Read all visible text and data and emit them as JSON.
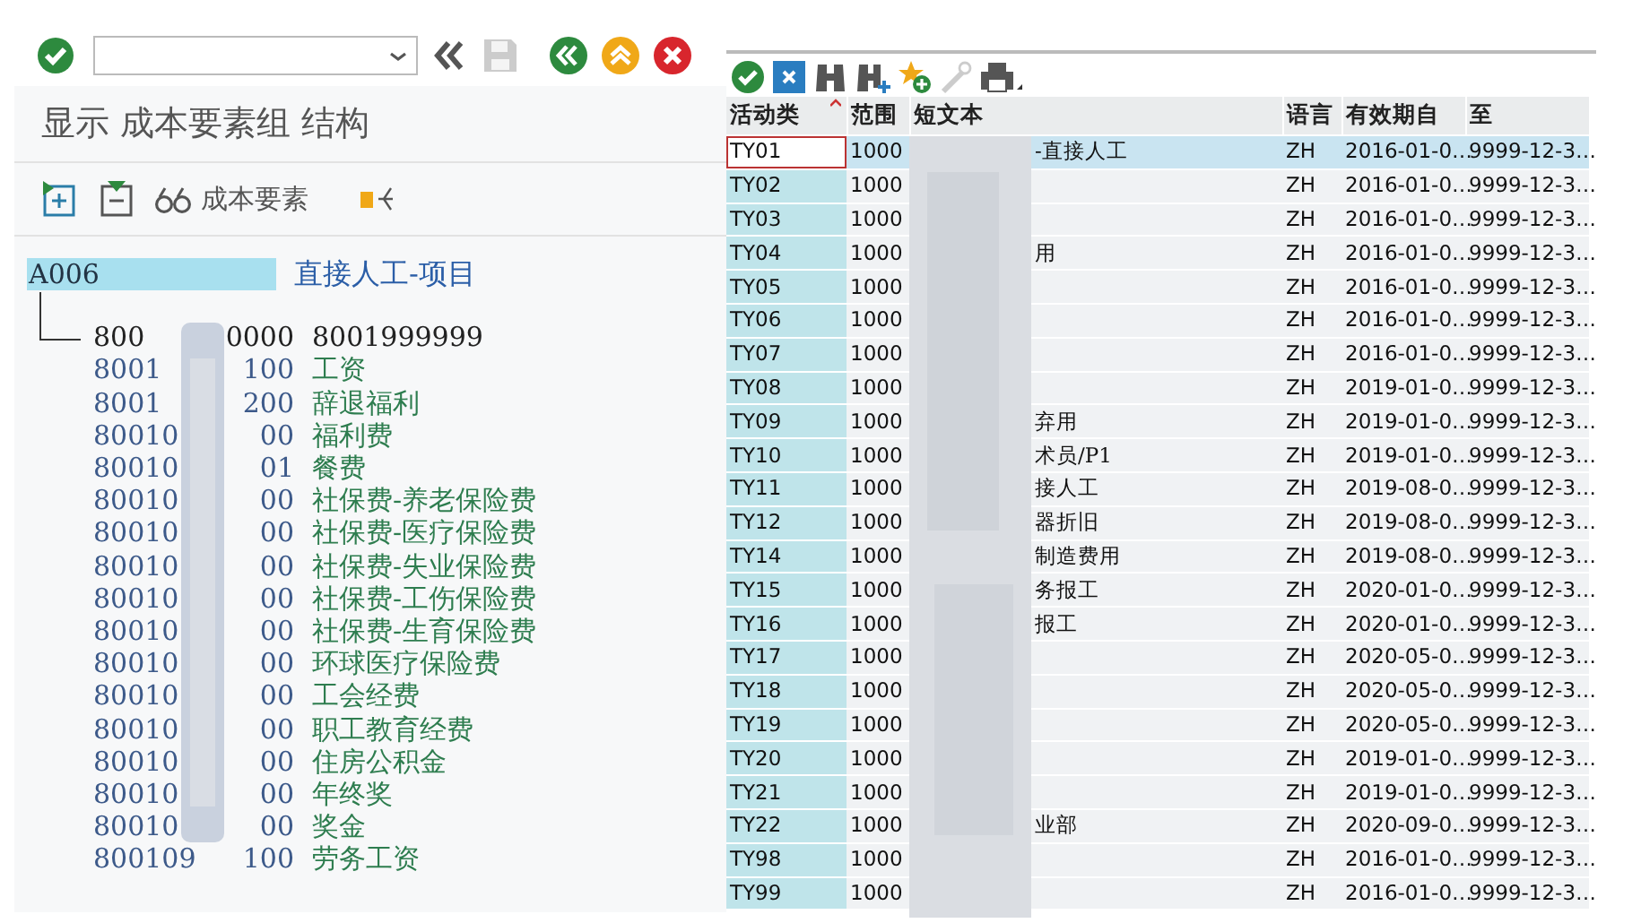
{
  "left_pane": {
    "title": "显示 成本要素组 结构",
    "cost_element_button": "成本要素",
    "tree": {
      "code": "A006",
      "text": "直接人工-项目",
      "selected": true,
      "children": [
        {
          "kind": "interval",
          "code_start": "800",
          "code_end": "0000",
          "text": "8001999999",
          "elements": [
            {
              "code_start": "8001",
              "code_end": "100",
              "text": "工资"
            },
            {
              "code_start": "8001",
              "code_end": "200",
              "text": "辞退福利"
            },
            {
              "code_start": "80010",
              "code_end": "00",
              "text": "福利费"
            },
            {
              "code_start": "80010",
              "code_end": "01",
              "text": "餐费"
            },
            {
              "code_start": "80010",
              "code_end": "00",
              "text": "社保费-养老保险费"
            },
            {
              "code_start": "80010",
              "code_end": "00",
              "text": "社保费-医疗保险费"
            },
            {
              "code_start": "80010",
              "code_end": "00",
              "text": "社保费-失业保险费"
            },
            {
              "code_start": "80010",
              "code_end": "00",
              "text": "社保费-工伤保险费"
            },
            {
              "code_start": "80010",
              "code_end": "00",
              "text": "社保费-生育保险费"
            },
            {
              "code_start": "80010",
              "code_end": "00",
              "text": "环球医疗保险费"
            },
            {
              "code_start": "80010",
              "code_end": "00",
              "text": "工会经费"
            },
            {
              "code_start": "80010",
              "code_end": "00",
              "text": "职工教育经费"
            },
            {
              "code_start": "80010",
              "code_end": "00",
              "text": "住房公积金"
            },
            {
              "code_start": "80010",
              "code_end": "00",
              "text": "年终奖"
            },
            {
              "code_start": "80010",
              "code_end": "00",
              "text": "奖金"
            },
            {
              "code_start": "800109",
              "code_end": "100",
              "text": "劳务工资"
            }
          ]
        }
      ]
    }
  },
  "grid": {
    "columns": [
      "活动类",
      "范围",
      "短文本",
      "语言",
      "有效期自",
      "至"
    ],
    "rows": [
      {
        "activity_type": "TY01",
        "range": "1000",
        "short_text": "-直接人工",
        "language": "ZH",
        "valid_from": "2016-01-0…",
        "valid_to": "9999-12-3…",
        "selected": true
      },
      {
        "activity_type": "TY02",
        "range": "1000",
        "language": "ZH",
        "valid_from": "2016-01-0…",
        "valid_to": "9999-12-3…",
        "selected": false
      },
      {
        "activity_type": "TY03",
        "range": "1000",
        "language": "ZH",
        "valid_from": "2016-01-0…",
        "valid_to": "9999-12-3…",
        "selected": false
      },
      {
        "activity_type": "TY04",
        "range": "1000",
        "short_text": "用",
        "language": "ZH",
        "valid_from": "2016-01-0…",
        "valid_to": "9999-12-3…",
        "selected": false
      },
      {
        "activity_type": "TY05",
        "range": "1000",
        "language": "ZH",
        "valid_from": "2016-01-0…",
        "valid_to": "9999-12-3…",
        "selected": false
      },
      {
        "activity_type": "TY06",
        "range": "1000",
        "language": "ZH",
        "valid_from": "2016-01-0…",
        "valid_to": "9999-12-3…",
        "selected": false
      },
      {
        "activity_type": "TY07",
        "range": "1000",
        "language": "ZH",
        "valid_from": "2016-01-0…",
        "valid_to": "9999-12-3…",
        "selected": false
      },
      {
        "activity_type": "TY08",
        "range": "1000",
        "language": "ZH",
        "valid_from": "2019-01-0…",
        "valid_to": "9999-12-3…",
        "selected": false
      },
      {
        "activity_type": "TY09",
        "range": "1000",
        "short_text": "弃用",
        "language": "ZH",
        "valid_from": "2019-01-0…",
        "valid_to": "9999-12-3…",
        "selected": false
      },
      {
        "activity_type": "TY10",
        "range": "1000",
        "short_text": "术员/P1",
        "language": "ZH",
        "valid_from": "2019-01-0…",
        "valid_to": "9999-12-3…",
        "selected": false
      },
      {
        "activity_type": "TY11",
        "range": "1000",
        "short_text": "接人工",
        "language": "ZH",
        "valid_from": "2019-08-0…",
        "valid_to": "9999-12-3…",
        "selected": false
      },
      {
        "activity_type": "TY12",
        "range": "1000",
        "short_text": "器折旧",
        "language": "ZH",
        "valid_from": "2019-08-0…",
        "valid_to": "9999-12-3…",
        "selected": false
      },
      {
        "activity_type": "TY14",
        "range": "1000",
        "short_text": "制造费用",
        "language": "ZH",
        "valid_from": "2019-08-0…",
        "valid_to": "9999-12-3…",
        "selected": false
      },
      {
        "activity_type": "TY15",
        "range": "1000",
        "short_text": "务报工",
        "language": "ZH",
        "valid_from": "2020-01-0…",
        "valid_to": "9999-12-3…",
        "selected": false
      },
      {
        "activity_type": "TY16",
        "range": "1000",
        "short_text": "报工",
        "language": "ZH",
        "valid_from": "2020-01-0…",
        "valid_to": "9999-12-3…",
        "selected": false
      },
      {
        "activity_type": "TY17",
        "range": "1000",
        "language": "ZH",
        "valid_from": "2020-05-0…",
        "valid_to": "9999-12-3…",
        "selected": false
      },
      {
        "activity_type": "TY18",
        "range": "1000",
        "language": "ZH",
        "valid_from": "2020-05-0…",
        "valid_to": "9999-12-3…",
        "selected": false
      },
      {
        "activity_type": "TY19",
        "range": "1000",
        "language": "ZH",
        "valid_from": "2020-05-0…",
        "valid_to": "9999-12-3…",
        "selected": false
      },
      {
        "activity_type": "TY20",
        "range": "1000",
        "language": "ZH",
        "valid_from": "2019-01-0…",
        "valid_to": "9999-12-3…",
        "selected": false
      },
      {
        "activity_type": "TY21",
        "range": "1000",
        "language": "ZH",
        "valid_from": "2019-01-0…",
        "valid_to": "9999-12-3…",
        "selected": false
      },
      {
        "activity_type": "TY22",
        "range": "1000",
        "short_text": "业部",
        "language": "ZH",
        "valid_from": "2020-09-0…",
        "valid_to": "9999-12-3…",
        "selected": false
      },
      {
        "activity_type": "TY98",
        "range": "1000",
        "language": "ZH",
        "valid_from": "2016-01-0…",
        "valid_to": "9999-12-3…",
        "selected": false
      },
      {
        "activity_type": "TY99",
        "range": "1000",
        "language": "ZH",
        "valid_from": "2016-01-0…",
        "valid_to": "9999-12-3…",
        "selected": false
      }
    ]
  }
}
